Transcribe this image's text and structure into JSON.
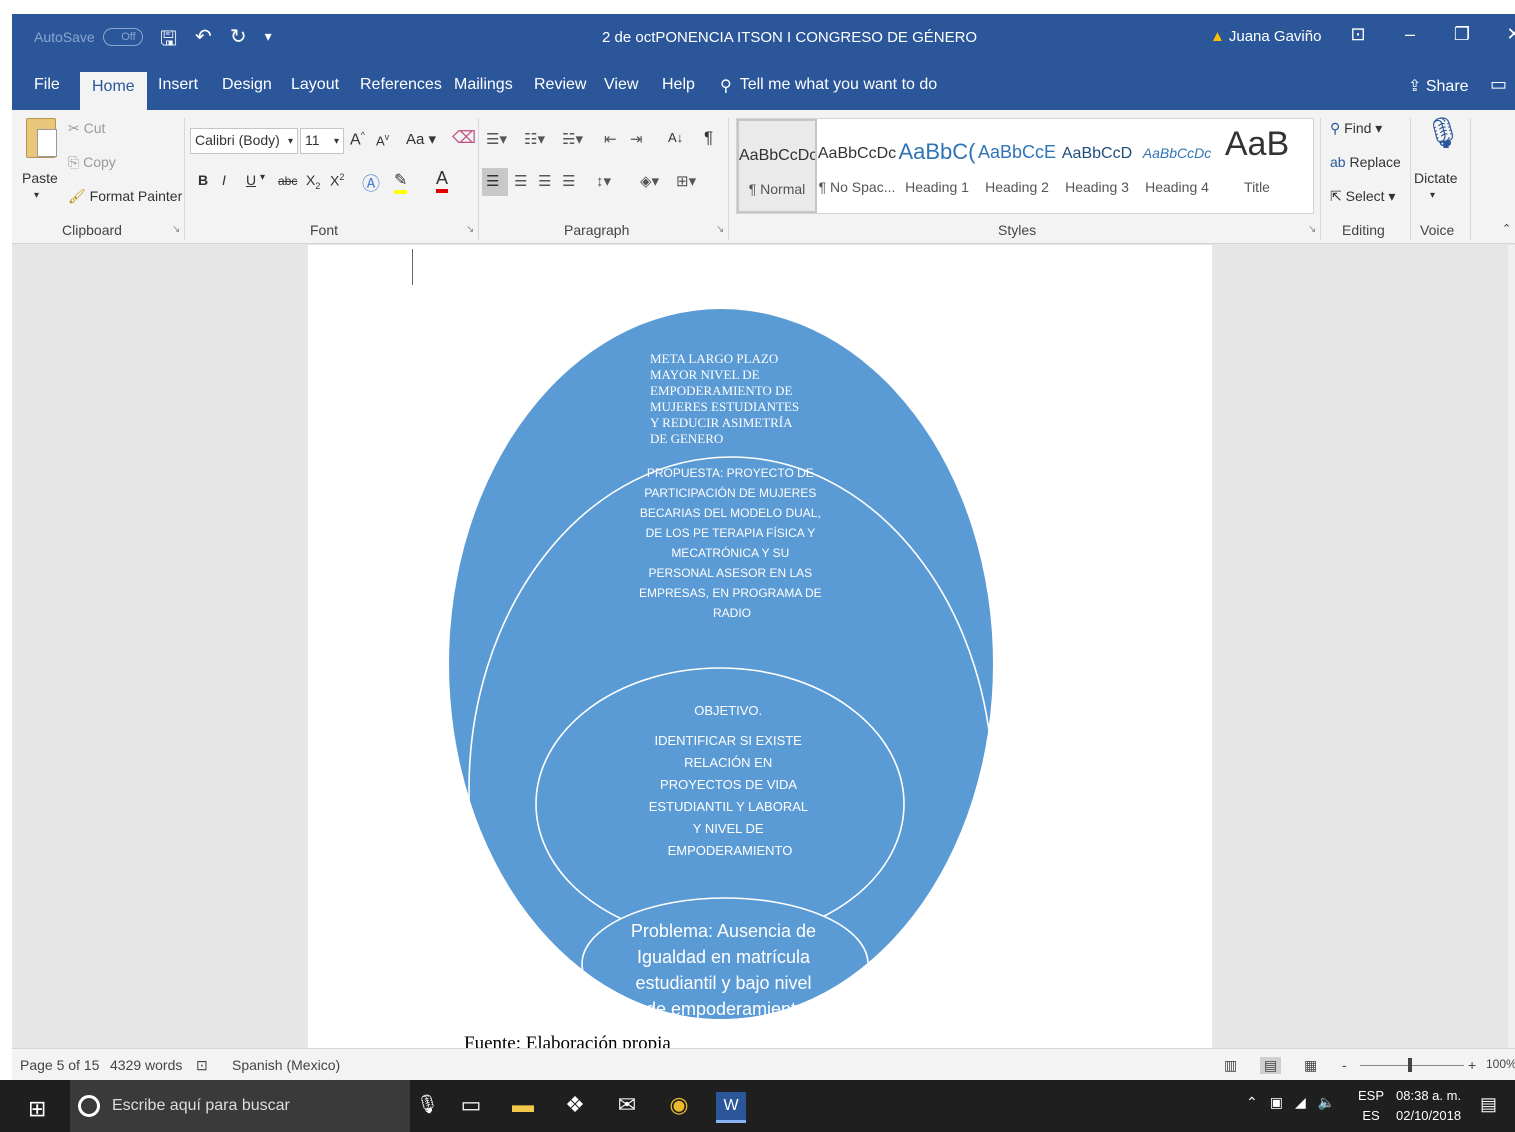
{
  "titlebar": {
    "autosave_label": "AutoSave",
    "autosave_state": "Off",
    "save_icon": "save-icon",
    "undo_icon": "undo-icon",
    "redo_icon": "redo-icon",
    "document_title": "2 de octPONENCIA ITSON I CONGRESO DE GÉNERO",
    "user_name": "Juana Gaviño",
    "warning_icon": "warning-icon"
  },
  "tabs": [
    {
      "label": "File"
    },
    {
      "label": "Home"
    },
    {
      "label": "Insert"
    },
    {
      "label": "Design"
    },
    {
      "label": "Layout"
    },
    {
      "label": "References"
    },
    {
      "label": "Mailings"
    },
    {
      "label": "Review"
    },
    {
      "label": "View"
    },
    {
      "label": "Help"
    }
  ],
  "active_tab": "Home",
  "tell_me": "Tell me what you want to do",
  "share_label": "Share",
  "ribbon": {
    "clipboard": {
      "paste": "Paste",
      "cut": "Cut",
      "copy": "Copy",
      "format_painter": "Format Painter",
      "label": "Clipboard"
    },
    "font": {
      "name": "Calibri (Body)",
      "size": "11",
      "grow": "A",
      "shrink": "A",
      "case": "Aa",
      "bold": "B",
      "italic": "I",
      "underline": "U",
      "strike": "abc",
      "subscript": "X",
      "superscript": "X",
      "color_letter": "A",
      "label": "Font"
    },
    "paragraph": {
      "sort": "A↓",
      "pilcrow": "¶",
      "label": "Paragraph"
    },
    "styles": {
      "items": [
        {
          "sample": "AaBbCcDc",
          "name": "¶ Normal"
        },
        {
          "sample": "AaBbCcDc",
          "name": "¶ No Spac..."
        },
        {
          "sample": "AaBbC(",
          "name": "Heading 1"
        },
        {
          "sample": "AaBbCcE",
          "name": "Heading 2"
        },
        {
          "sample": "AaBbCcD",
          "name": "Heading 3"
        },
        {
          "sample": "AaBbCcDc",
          "name": "Heading 4"
        },
        {
          "sample": "AaB",
          "name": "Title"
        }
      ],
      "label": "Styles"
    },
    "editing": {
      "find": "Find",
      "replace": "Replace",
      "select": "Select",
      "label": "Editing"
    },
    "voice": {
      "dictate": "Dictate",
      "label": "Voice"
    }
  },
  "document": {
    "diagram": {
      "outer": {
        "lines": [
          "META LARGO PLAZO",
          "MAYOR NIVEL DE",
          "EMPODERAMIENTO DE",
          "MUJERES ESTUDIANTES",
          "Y REDUCIR ASIMETRÍA",
          "DE GENERO"
        ],
        "fill": "#5b9bd5"
      },
      "second": {
        "lines": [
          "PROPUESTA: PROYECTO DE",
          "PARTICIPACIÓN DE MUJERES",
          "BECARIAS DEL MODELO DUAL,",
          "DE LOS PE TERAPIA FÍSICA Y",
          "MECATRÓNICA Y SU",
          "PERSONAL ASESOR EN LAS",
          "EMPRESAS, EN PROGRAMA DE",
          "RADIO"
        ]
      },
      "third": {
        "lines": [
          "OBJETIVO.",
          "",
          "IDENTIFICAR SI EXISTE",
          "RELACIÓN EN",
          "PROYECTOS DE VIDA",
          "ESTUDIANTIL Y LABORAL",
          "Y NIVEL DE",
          "EMPODERAMIENTO"
        ]
      },
      "inner": {
        "lines": [
          "Problema: Ausencia de",
          "Igualdad en matrícula",
          "estudiantil y bajo nivel",
          "de empoderamiento"
        ]
      }
    },
    "caption": "Fuente: Elaboración propia"
  },
  "statusbar": {
    "page": "Page 5 of 15",
    "words": "4329 words",
    "language": "Spanish (Mexico)",
    "zoom": "100%",
    "zoom_minus": "-",
    "zoom_plus": "+"
  },
  "taskbar": {
    "search_placeholder": "Escribe aquí para buscar",
    "lang_top": "ESP",
    "lang_bottom": "ES",
    "time": "08:38 a. m.",
    "date": "02/10/2018"
  },
  "colors": {
    "brand": "#2b579a",
    "diagram_fill": "#5b9bd5",
    "diagram_stroke": "#ffffff"
  }
}
